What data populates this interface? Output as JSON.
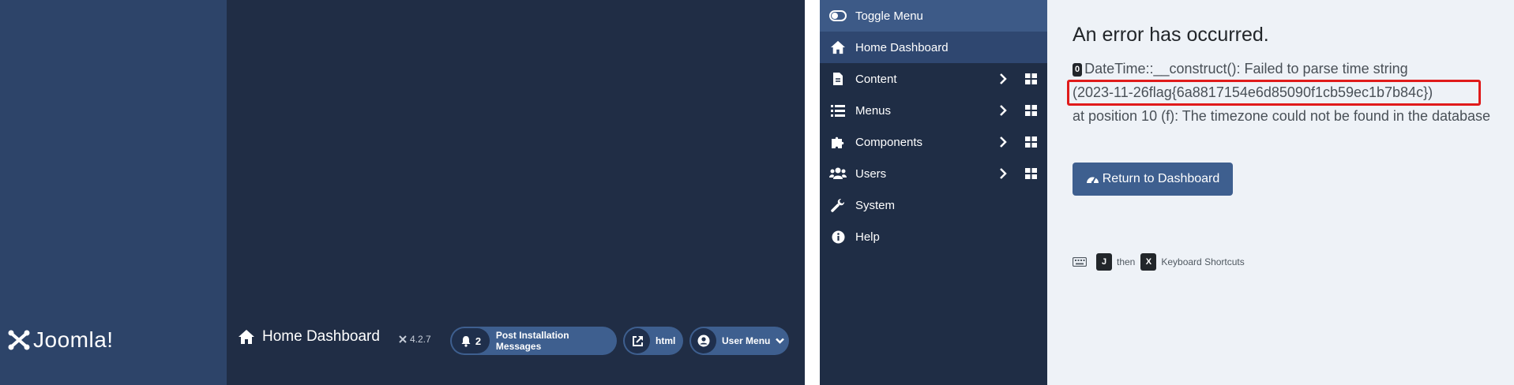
{
  "header": {
    "logo_text": "Joomla!",
    "page_title": "Home Dashboard",
    "version": "4.2.7",
    "notifications": {
      "count": "2",
      "label": "Post Installation Messages"
    },
    "site_link": "html",
    "user_menu": "User Menu"
  },
  "sidebar": {
    "items": [
      {
        "label": "Toggle Menu",
        "icon": "toggle-icon"
      },
      {
        "label": "Home Dashboard",
        "icon": "home-icon"
      },
      {
        "label": "Content",
        "icon": "file-icon"
      },
      {
        "label": "Menus",
        "icon": "list-icon"
      },
      {
        "label": "Components",
        "icon": "puzzle-icon"
      },
      {
        "label": "Users",
        "icon": "users-icon"
      },
      {
        "label": "System",
        "icon": "wrench-icon"
      },
      {
        "label": "Help",
        "icon": "info-icon"
      }
    ]
  },
  "error": {
    "title": "An error has occurred.",
    "code": "0",
    "message_before": "DateTime::__construct(): Failed to parse time string",
    "message_highlight": "(2023-11-26flag{6a8817154e6d85090f1cb59ec1b7b84c})",
    "message_after": "at position 10 (f): The timezone could not be found in the database",
    "return_label": "Return to Dashboard"
  },
  "shortcuts": {
    "key1": "J",
    "then": "then",
    "key2": "X",
    "label": "Keyboard Shortcuts"
  },
  "colors": {
    "header_bg": "#202d45",
    "logo_bg": "#2d4469",
    "pill_bg": "#3e5f8f",
    "sidebar_bg": "#1f2d45",
    "main_bg": "#eef2f7",
    "highlight_border": "#e01b1b"
  }
}
